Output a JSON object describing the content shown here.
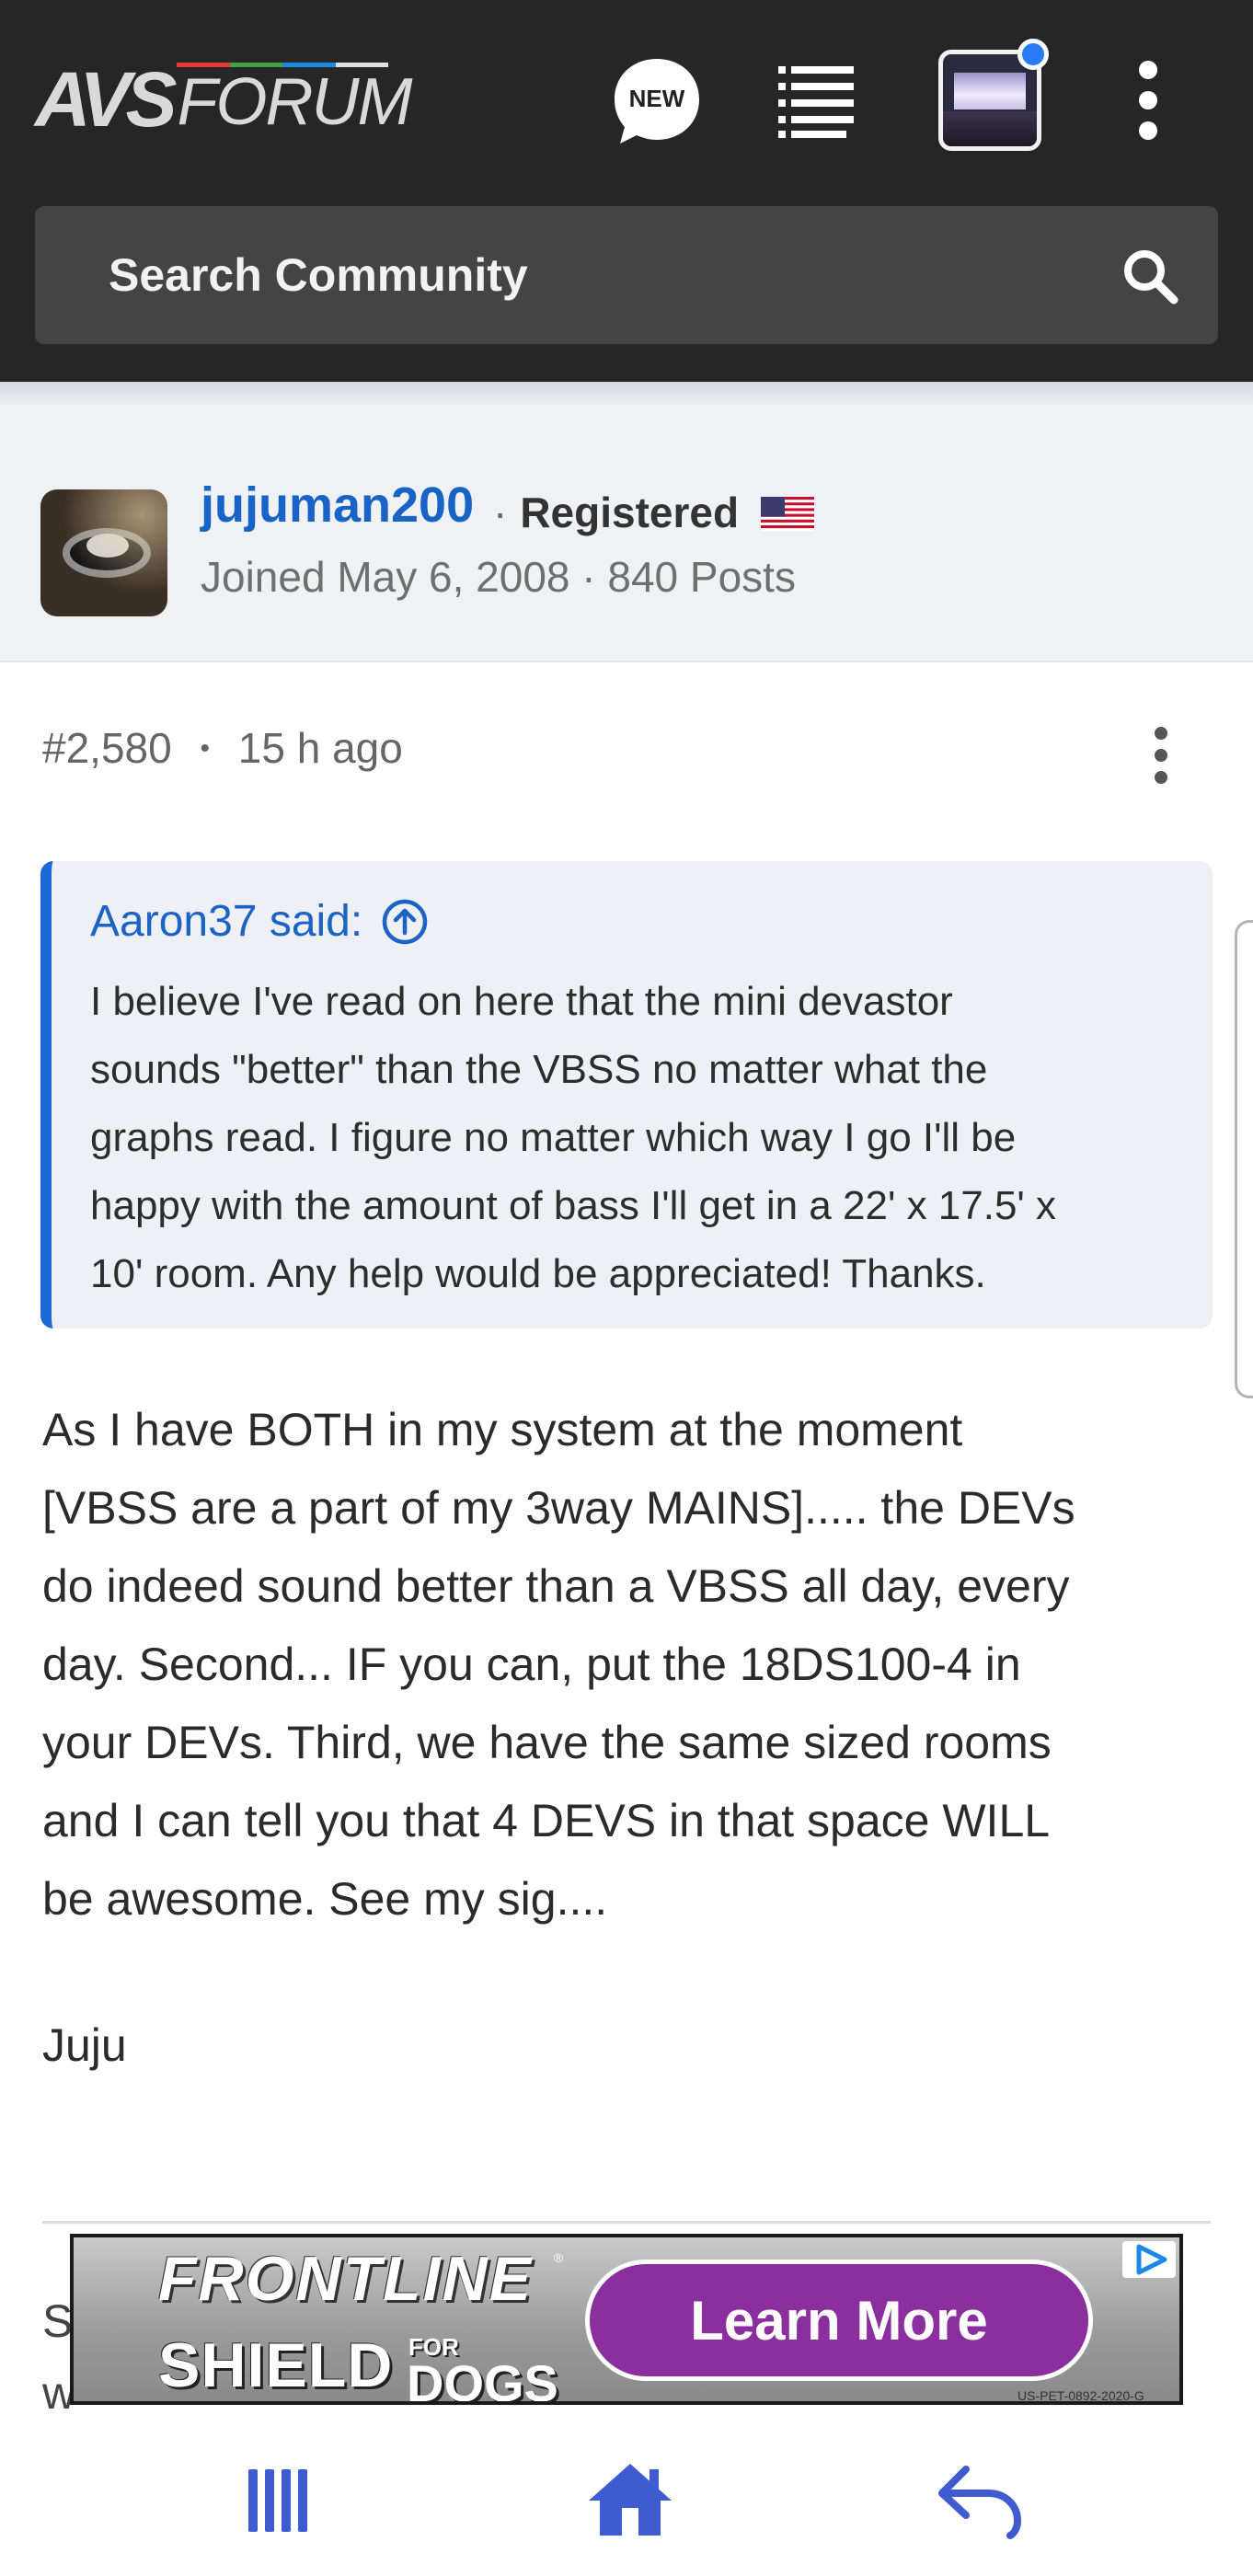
{
  "header": {
    "logo_primary": "AVS",
    "logo_secondary": "FORUM",
    "new_badge": "NEW",
    "search_placeholder": "Search Community"
  },
  "author": {
    "username": "jujuman200",
    "separator": "·",
    "role": "Registered",
    "joined": "Joined May 6, 2008 · 840 Posts"
  },
  "post": {
    "number": "#2,580",
    "bullet": "•",
    "time": "15 h ago",
    "quote_author": "Aaron37 said:",
    "quote_lines": [
      "I believe I've read on here that the mini devastor",
      "sounds \"better\" than the VBSS no matter what the",
      "graphs read. I figure no matter which way I go I'll be",
      "happy with the amount of bass I'll get in a 22' x 17.5' x",
      "10' room. Any help would be appreciated! Thanks."
    ],
    "body_lines": [
      "As I have BOTH in my system at the moment",
      "[VBSS are a part of my 3way MAINS]..... the DEVs",
      "do indeed sound better than a VBSS all day, every",
      "day. Second... IF you can, put the 18DS100-4 in",
      "your DEVs. Third, we have the same sized rooms",
      "and I can tell you that 4 DEVS in that space WILL",
      "be awesome. See my sig...."
    ],
    "signoff": "Juju",
    "next_peek_1": "S",
    "next_peek_2": "w"
  },
  "ad": {
    "brand_line1": "FRONTLINE",
    "brand_reg": "®",
    "brand_line2": "SHIELD",
    "brand_for": "FOR",
    "brand_dogs": "DOGS",
    "cta": "Learn More",
    "code": "US-PET-0892-2020-G"
  },
  "colors": {
    "header_bg": "#262626",
    "link_blue": "#1763c6",
    "quote_bar": "#1b68d6",
    "ad_cta": "#8c2f9e",
    "nav_icon": "#3f5bd0"
  },
  "icons": {
    "new": "new-chat-bubble-icon",
    "activity": "list-icon",
    "more": "vertical-dots-icon",
    "search": "search-icon",
    "quote_jump": "arrow-up-circle-icon",
    "nav_recent": "recent-apps-icon",
    "nav_home": "home-icon",
    "nav_back": "back-arrow-icon"
  }
}
